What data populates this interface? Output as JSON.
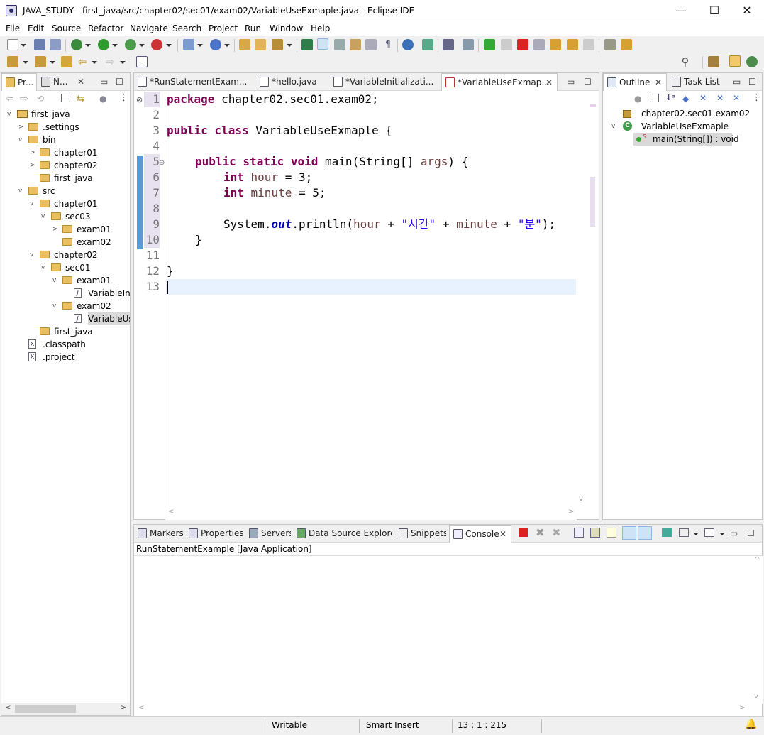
{
  "window": {
    "title": "JAVA_STUDY - first_java/src/chapter02/sec01/exam02/VariableUseExmaple.java - Eclipse IDE",
    "min": "—",
    "max": "☐",
    "close": "✕"
  },
  "menu": [
    "File",
    "Edit",
    "Source",
    "Refactor",
    "Navigate",
    "Search",
    "Project",
    "Run",
    "Window",
    "Help"
  ],
  "left_panel": {
    "tabs": [
      "Pr...",
      "N..."
    ],
    "close": "✕",
    "tree": [
      {
        "label": "first_java",
        "depth": 0,
        "kind": "project",
        "twisty": "v"
      },
      {
        "label": ".settings",
        "depth": 1,
        "kind": "folder",
        "twisty": ">"
      },
      {
        "label": "bin",
        "depth": 1,
        "kind": "folder",
        "twisty": "v"
      },
      {
        "label": "chapter01",
        "depth": 2,
        "kind": "folder",
        "twisty": ">"
      },
      {
        "label": "chapter02",
        "depth": 2,
        "kind": "folder",
        "twisty": ">"
      },
      {
        "label": "first_java",
        "depth": 2,
        "kind": "folder",
        "twisty": ""
      },
      {
        "label": "src",
        "depth": 1,
        "kind": "folder",
        "twisty": "v"
      },
      {
        "label": "chapter01",
        "depth": 2,
        "kind": "folder",
        "twisty": "v"
      },
      {
        "label": "sec03",
        "depth": 3,
        "kind": "folder",
        "twisty": "v"
      },
      {
        "label": "exam01",
        "depth": 4,
        "kind": "folder",
        "twisty": ">"
      },
      {
        "label": "exam02",
        "depth": 4,
        "kind": "folder",
        "twisty": ""
      },
      {
        "label": "chapter02",
        "depth": 2,
        "kind": "folder",
        "twisty": "v"
      },
      {
        "label": "sec01",
        "depth": 3,
        "kind": "folder",
        "twisty": "v"
      },
      {
        "label": "exam01",
        "depth": 4,
        "kind": "folder",
        "twisty": "v"
      },
      {
        "label": "VariableIni",
        "depth": 5,
        "kind": "java",
        "twisty": ""
      },
      {
        "label": "exam02",
        "depth": 4,
        "kind": "folder",
        "twisty": "v"
      },
      {
        "label": "VariableUs",
        "depth": 5,
        "kind": "java",
        "twisty": "",
        "selected": true
      },
      {
        "label": "first_java",
        "depth": 2,
        "kind": "folder",
        "twisty": ""
      },
      {
        "label": ".classpath",
        "depth": 1,
        "kind": "xml",
        "twisty": ""
      },
      {
        "label": ".project",
        "depth": 1,
        "kind": "xml",
        "twisty": ""
      }
    ]
  },
  "editor": {
    "tabs": [
      {
        "label": "*RunStatementExam...",
        "active": false
      },
      {
        "label": "*hello.java",
        "active": false
      },
      {
        "label": "*VariableInitializati...",
        "active": false
      },
      {
        "label": "*VariableUseExmap...",
        "active": true
      }
    ],
    "line_numbers": [
      "1",
      "2",
      "3",
      "4",
      "5",
      "6",
      "7",
      "8",
      "9",
      "10",
      "11",
      "12",
      "13"
    ],
    "code": {
      "l1_kw": "package",
      "l1_rest": " chapter02.sec01.exam02;",
      "l3_kw": "public class",
      "l3_rest": " VariableUseExmaple {",
      "l5_kw": "public static void",
      "l5_rest": " main(String[] ",
      "l5_var": "args",
      "l5_end": ") {",
      "l6_kw": "int",
      "l6_var": " hour",
      "l6_rest": " = 3;",
      "l7_kw": "int",
      "l7_var": " minute",
      "l7_rest": " = 5;",
      "l9_a": "System.",
      "l9_field": "out",
      "l9_b": ".println(",
      "l9_v1": "hour",
      "l9_c": " + ",
      "l9_s1": "\"시간\"",
      "l9_d": " + ",
      "l9_v2": "minute",
      "l9_e": " + ",
      "l9_s2": "\"분\"",
      "l9_f": ");",
      "l10": "}",
      "l12": "}"
    }
  },
  "outline": {
    "tabs": [
      "Outline",
      "Task List"
    ],
    "items": [
      {
        "label": "chapter02.sec01.exam02",
        "kind": "package"
      },
      {
        "label": "VariableUseExmaple",
        "kind": "class"
      },
      {
        "label": "main(String[]) : void",
        "kind": "method",
        "selected": true
      }
    ]
  },
  "bottom_panel": {
    "tabs": [
      "Markers",
      "Properties",
      "Servers",
      "Data Source Explorer",
      "Snippets",
      "Console"
    ],
    "console_title": "RunStatementExample [Java Application]"
  },
  "status": {
    "writable": "Writable",
    "insert_mode": "Smart Insert",
    "position": "13 : 1 : 215"
  },
  "colors": {
    "keyword": "#7f0055",
    "string": "#2a00ff",
    "field": "#0000c0",
    "local": "#6a3e3e",
    "selection": "#cce8ff"
  }
}
